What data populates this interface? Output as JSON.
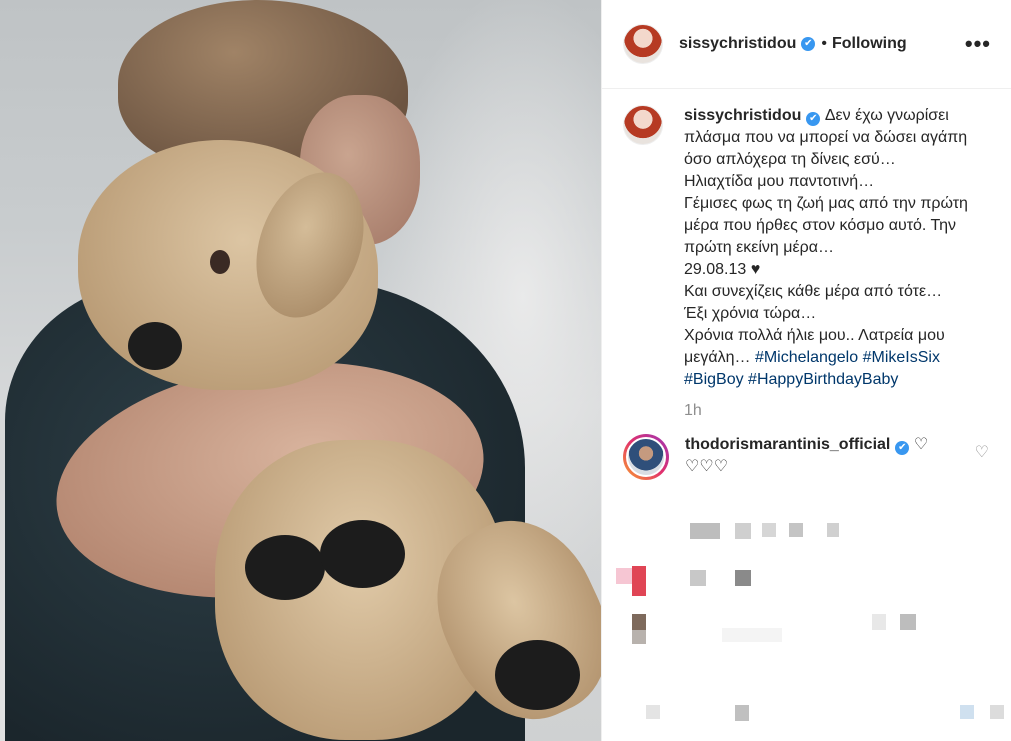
{
  "post": {
    "image_alt": "Child hugging a teddy bear"
  },
  "header": {
    "username": "sissychristidou",
    "verified_icon": "✔",
    "separator": "•",
    "follow_status": "Following",
    "more_icon": "•••"
  },
  "caption": {
    "username": "sissychristidou",
    "verified_icon": "✔",
    "lines": [
      "Δεν έχω γνωρίσει πλάσμα που να μπορεί να δώσει αγάπη όσο απλόχερα τη δίνεις εσύ…",
      "Ηλιαχτίδα μου παντοτινή…",
      "Γέμισες φως τη ζωή μας από την πρώτη μέρα που ήρθες στον κόσμο αυτό. Την πρώτη εκείνη μέρα…",
      "29.08.13 ♥",
      "Και συνεχίζεις κάθε μέρα από τότε…",
      "Έξι χρόνια τώρα…",
      "Χρόνια πολλά ήλιε μου.. Λατρεία μου μεγάλη…"
    ],
    "hashtags": [
      "#Michelangelo",
      "#MikeIsSix",
      "#BigBoy",
      "#HappyBirthdayBaby"
    ]
  },
  "timestamp": "1h",
  "comment": {
    "username": "thodorismarantinis_official",
    "verified_icon": "✔",
    "text_after_name": "♡",
    "text_line2": "♡♡♡",
    "like_icon": "♡"
  },
  "colors": {
    "link": "#00376b",
    "verified": "#3897f0",
    "muted": "#8e8e8e"
  }
}
